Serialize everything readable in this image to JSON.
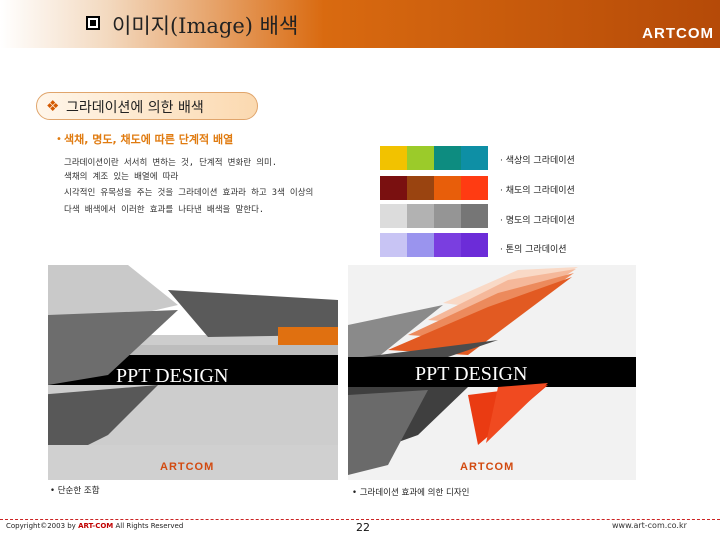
{
  "header": {
    "title": "이미지(Image) 배색",
    "brand": "ARTCOM"
  },
  "section": {
    "title": "그라데이션에 의한 배색",
    "subtitle": "색채, 명도, 채도에 따른 단계적 배열",
    "description": [
      "그라데이션이란 서서히 변하는 것, 단계적 변화란 의미.",
      "색채의 계조 있는 배열에 따라",
      "시각적인 유목성을 주는 것을 그라데이션 효과라 하고 3색 이상의",
      "다색 배색에서 이러한 효과를 나타낸 배색을 말한다."
    ]
  },
  "swatches": [
    {
      "label": "· 색상의 그라데이션",
      "colors": [
        "#f2c200",
        "#9bcb2a",
        "#0d8c80",
        "#0e8fa5"
      ]
    },
    {
      "label": "· 채도의 그라데이션",
      "colors": [
        "#7a1010",
        "#9a4410",
        "#e85e0a",
        "#ff3b12"
      ]
    },
    {
      "label": "· 명도의 그라데이션",
      "colors": [
        "#dcdcdc",
        "#b2b2b2",
        "#959595",
        "#767676"
      ]
    },
    {
      "label": "· 톤의 그라데이션",
      "colors": [
        "#c8c4f4",
        "#9a94ee",
        "#7a3ee0",
        "#6c2cd8"
      ]
    }
  ],
  "images": [
    {
      "design_text": "PPT DESIGN",
      "brand": "ARTCOM",
      "caption": "• 단순한 조합"
    },
    {
      "design_text": "PPT DESIGN",
      "brand": "ARTCOM",
      "caption": "• 그라데이션 효과에 의한 디자인"
    }
  ],
  "footer": {
    "copyright_prefix": "Copyright©2003 by ",
    "copyright_brand": "ART-COM",
    "copyright_suffix": " All Rights Reserved",
    "page": "22",
    "website": "www.art-com.co.kr"
  }
}
